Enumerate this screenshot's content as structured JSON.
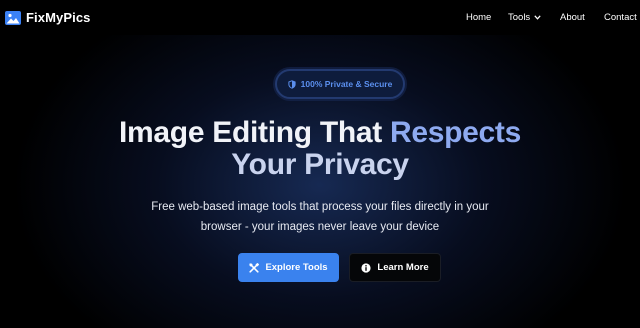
{
  "brand": {
    "name": "FixMyPics",
    "icon": "image-icon",
    "color": "#3b82f6"
  },
  "nav": {
    "items": [
      {
        "label": "Home"
      },
      {
        "label": "Tools",
        "has_dropdown": true,
        "icon": "chevron-down-icon"
      },
      {
        "label": "About"
      },
      {
        "label": "Contact"
      }
    ]
  },
  "hero": {
    "badge": {
      "icon": "shield-icon",
      "text": "100% Private & Secure"
    },
    "headline": {
      "line1_part1": "Image Editing That ",
      "line1_part2": "Respects",
      "line2": "Your Privacy"
    },
    "subtitle": {
      "line1": "Free web-based image tools that process your files directly in your",
      "line2": "browser - your images never leave your device"
    },
    "primary_button": {
      "label": "Explore Tools",
      "icon": "tools-icon"
    },
    "secondary_button": {
      "label": "Learn More",
      "icon": "info-icon"
    }
  },
  "colors": {
    "accent": "#3a82ee",
    "background": "#000000",
    "badge_text": "#5b8fee"
  }
}
